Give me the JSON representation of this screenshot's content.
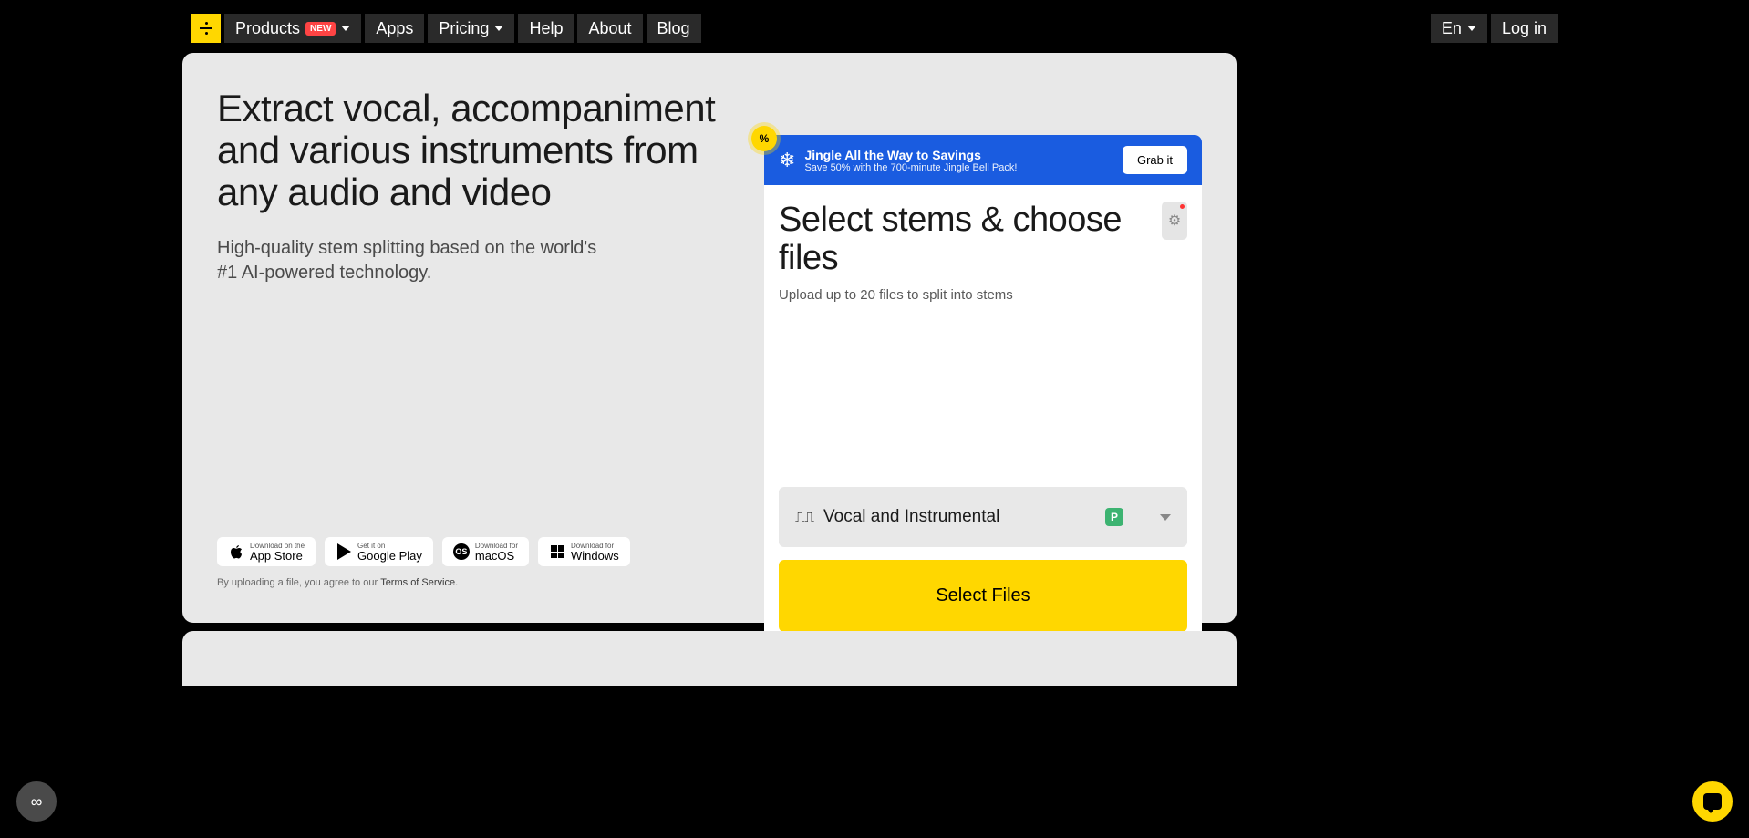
{
  "nav": {
    "products": "Products",
    "products_badge": "NEW",
    "apps": "Apps",
    "pricing": "Pricing",
    "help": "Help",
    "about": "About",
    "blog": "Blog",
    "language": "En",
    "login": "Log in"
  },
  "hero": {
    "title": "Extract vocal, accompaniment and various instruments from any audio and video",
    "subtitle": "High-quality stem splitting based on the world's #1 AI-powered technology."
  },
  "downloads": {
    "appstore_small": "Download on the",
    "appstore_big": "App Store",
    "play_small": "Get it on",
    "play_big": "Google Play",
    "macos_small": "Download for",
    "macos_big": "macOS",
    "windows_small": "Download for",
    "windows_big": "Windows"
  },
  "tos": {
    "prefix": "By uploading a file, you agree to our ",
    "link": "Terms of Service."
  },
  "promo": {
    "badge": "%",
    "title": "Jingle All the Way to Savings",
    "subtitle": "Save 50% with the 700-minute Jingle Bell Pack!",
    "button": "Grab it"
  },
  "upload": {
    "title": "Select stems & choose files",
    "caption": "Upload up to 20 files to split into stems",
    "stem_option": "Vocal and Instrumental",
    "preset_badge": "P",
    "select_button": "Select Files"
  },
  "widget_icon": "∞"
}
